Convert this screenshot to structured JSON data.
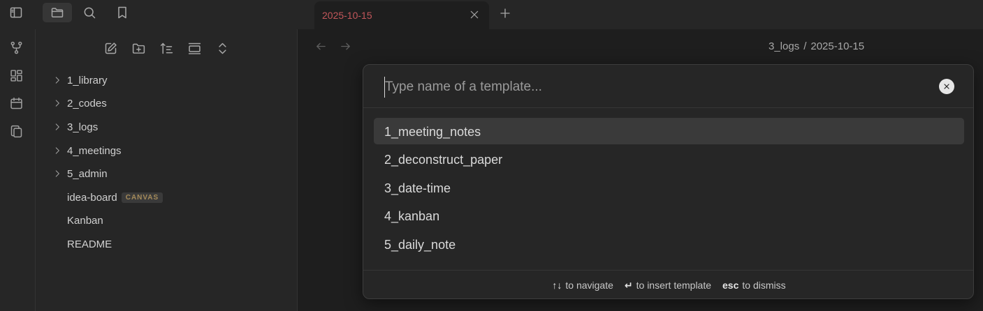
{
  "tab": {
    "title": "2025-10-15"
  },
  "breadcrumb": {
    "folder": "3_logs",
    "separator": "/",
    "file": "2025-10-15"
  },
  "sidebar": {
    "tree": [
      {
        "label": "1_library",
        "type": "folder"
      },
      {
        "label": "2_codes",
        "type": "folder"
      },
      {
        "label": "3_logs",
        "type": "folder"
      },
      {
        "label": "4_meetings",
        "type": "folder"
      },
      {
        "label": "5_admin",
        "type": "folder"
      },
      {
        "label": "idea-board",
        "type": "file",
        "badge": "CANVAS"
      },
      {
        "label": "Kanban",
        "type": "file"
      },
      {
        "label": "README",
        "type": "file"
      }
    ]
  },
  "modal": {
    "placeholder": "Type name of a template...",
    "suggestions": [
      {
        "label": "1_meeting_notes"
      },
      {
        "label": "2_deconstruct_paper"
      },
      {
        "label": "3_date-time"
      },
      {
        "label": "4_kanban"
      },
      {
        "label": "5_daily_note"
      }
    ],
    "instructions": [
      {
        "command": "↑↓",
        "purpose": "to navigate"
      },
      {
        "command": "↵",
        "purpose": "to insert template"
      },
      {
        "command": "esc",
        "purpose": "to dismiss"
      }
    ]
  },
  "colors": {
    "background": "#1e1e1e",
    "panel": "#262626",
    "tab_title": "#c2565a",
    "badge_text": "#a58b5a",
    "selected_row": "#3a3a3a"
  },
  "icons": {
    "topbar": [
      "sidebar-toggle-icon",
      "folder-icon",
      "search-icon",
      "bookmark-icon"
    ],
    "ribbon": [
      "graph-icon",
      "dashboard-icon",
      "calendar-icon",
      "copy-icon"
    ],
    "nav_actions": [
      "new-note-icon",
      "new-folder-icon",
      "sort-icon",
      "collapse-icon",
      "expand-collapse-icon"
    ]
  }
}
